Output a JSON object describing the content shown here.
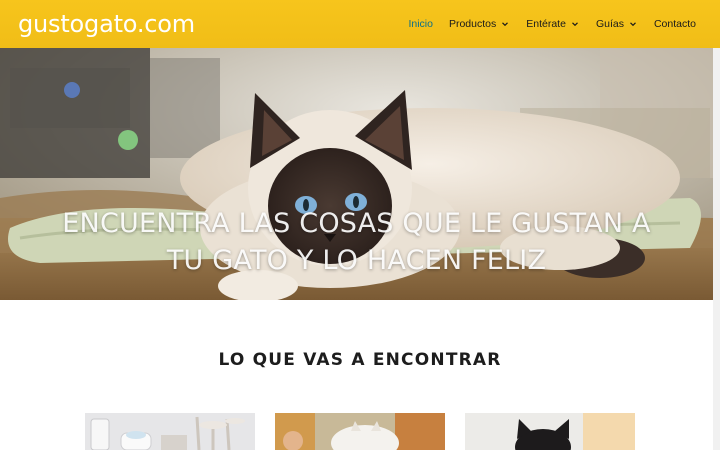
{
  "header": {
    "logo": "gustogato.com",
    "nav": [
      {
        "label": "Inicio",
        "active": true,
        "dropdown": false
      },
      {
        "label": "Productos",
        "active": false,
        "dropdown": true
      },
      {
        "label": "Entérate",
        "active": false,
        "dropdown": true
      },
      {
        "label": "Guías",
        "active": false,
        "dropdown": true
      },
      {
        "label": "Contacto",
        "active": false,
        "dropdown": false
      }
    ],
    "colors": {
      "background": "#f7c51c",
      "active_link": "#0b6f8a",
      "link": "#1a1a1a"
    }
  },
  "hero": {
    "title_line1": "ENCUENTRA LAS COSAS QUE LE GUSTAN A",
    "title_line2": "TU GATO Y LO HACEN FELIZ"
  },
  "section": {
    "title": "LO QUE VAS A ENCONTRAR"
  }
}
